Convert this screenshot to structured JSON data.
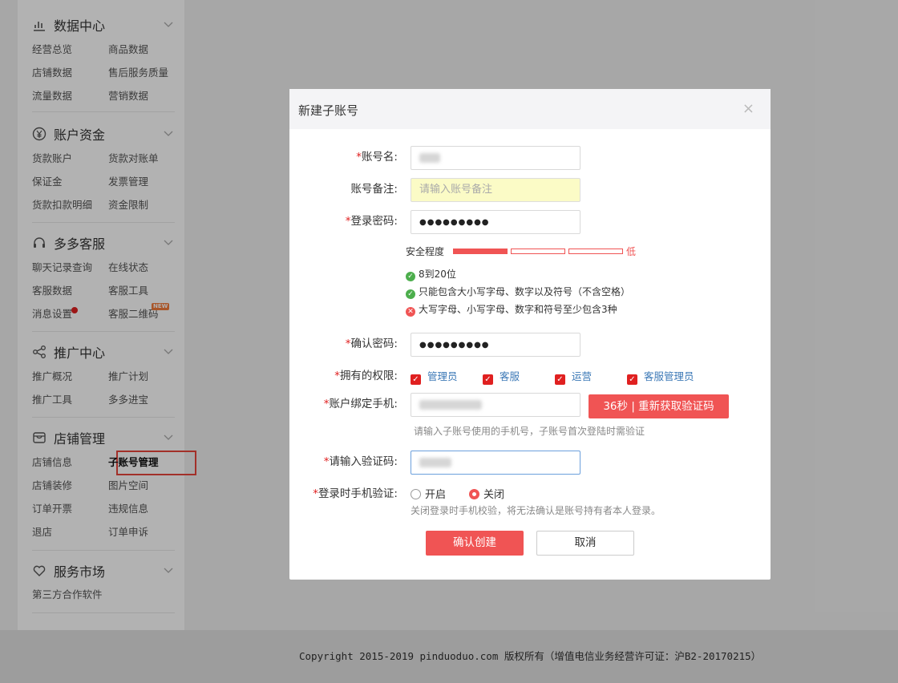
{
  "sidebar": {
    "sections": [
      {
        "title": "数据中心",
        "icon": "bar-chart-icon",
        "links": [
          "经营总览",
          "商品数据",
          "店铺数据",
          "售后服务质量",
          "流量数据",
          "营销数据"
        ]
      },
      {
        "title": "账户资金",
        "icon": "yen-icon",
        "links": [
          "货款账户",
          "货款对账单",
          "保证金",
          "发票管理",
          "货款扣款明细",
          "资金限制"
        ]
      },
      {
        "title": "多多客服",
        "icon": "headset-icon",
        "links": [
          "聊天记录查询",
          "在线状态",
          "客服数据",
          "客服工具",
          "消息设置",
          "客服二维码"
        ],
        "new_badge": "NEW"
      },
      {
        "title": "推广中心",
        "icon": "share-icon",
        "links": [
          "推广概况",
          "推广计划",
          "推广工具",
          "多多进宝"
        ]
      },
      {
        "title": "店铺管理",
        "icon": "store-icon",
        "links": [
          "店铺信息",
          "子账号管理",
          "店铺装修",
          "图片空间",
          "订单开票",
          "违规信息",
          "退店",
          "订单申诉"
        ]
      },
      {
        "title": "服务市场",
        "icon": "heart-icon",
        "links": [
          "第三方合作软件"
        ]
      }
    ]
  },
  "dialog": {
    "title": "新建子账号",
    "close": "×",
    "account_name_label": "账号名:",
    "account_note_label": "账号备注:",
    "account_note_placeholder": "请输入账号备注",
    "password_label": "登录密码:",
    "password_mask": "●●●●●●●●●",
    "strength_label": "安全程度",
    "strength_value": "低",
    "strength_level": 1,
    "strength_total": 3,
    "rules": [
      {
        "status": "ok",
        "text": "8到20位"
      },
      {
        "status": "ok",
        "text": "只能包含大小写字母、数字以及符号（不含空格）"
      },
      {
        "status": "fail",
        "text": "大写字母、小写字母、数字和符号至少包含3种"
      }
    ],
    "confirm_label": "确认密码:",
    "confirm_mask": "●●●●●●●●●",
    "permissions_label": "拥有的权限:",
    "permissions": [
      "管理员",
      "客服",
      "运营",
      "客服管理员"
    ],
    "phone_label": "账户绑定手机:",
    "sms_button": "36秒  |  重新获取验证码",
    "phone_hint": "请输入子账号使用的手机号，子账号首次登陆时需验证",
    "code_label": "请输入验证码:",
    "login_verify_label": "登录时手机验证:",
    "radio_on": "开启",
    "radio_off": "关闭",
    "selected": "关闭",
    "verify_hint": "关闭登录时手机校验，将无法确认是账号持有者本人登录。",
    "confirm_button": "确认创建",
    "cancel_button": "取消",
    "required_mark": "*"
  },
  "footer": {
    "copyright": "Copyright 2015-2019 pinduoduo.com 版权所有（增值电信业务经营许可证：沪B2-20170215）"
  }
}
